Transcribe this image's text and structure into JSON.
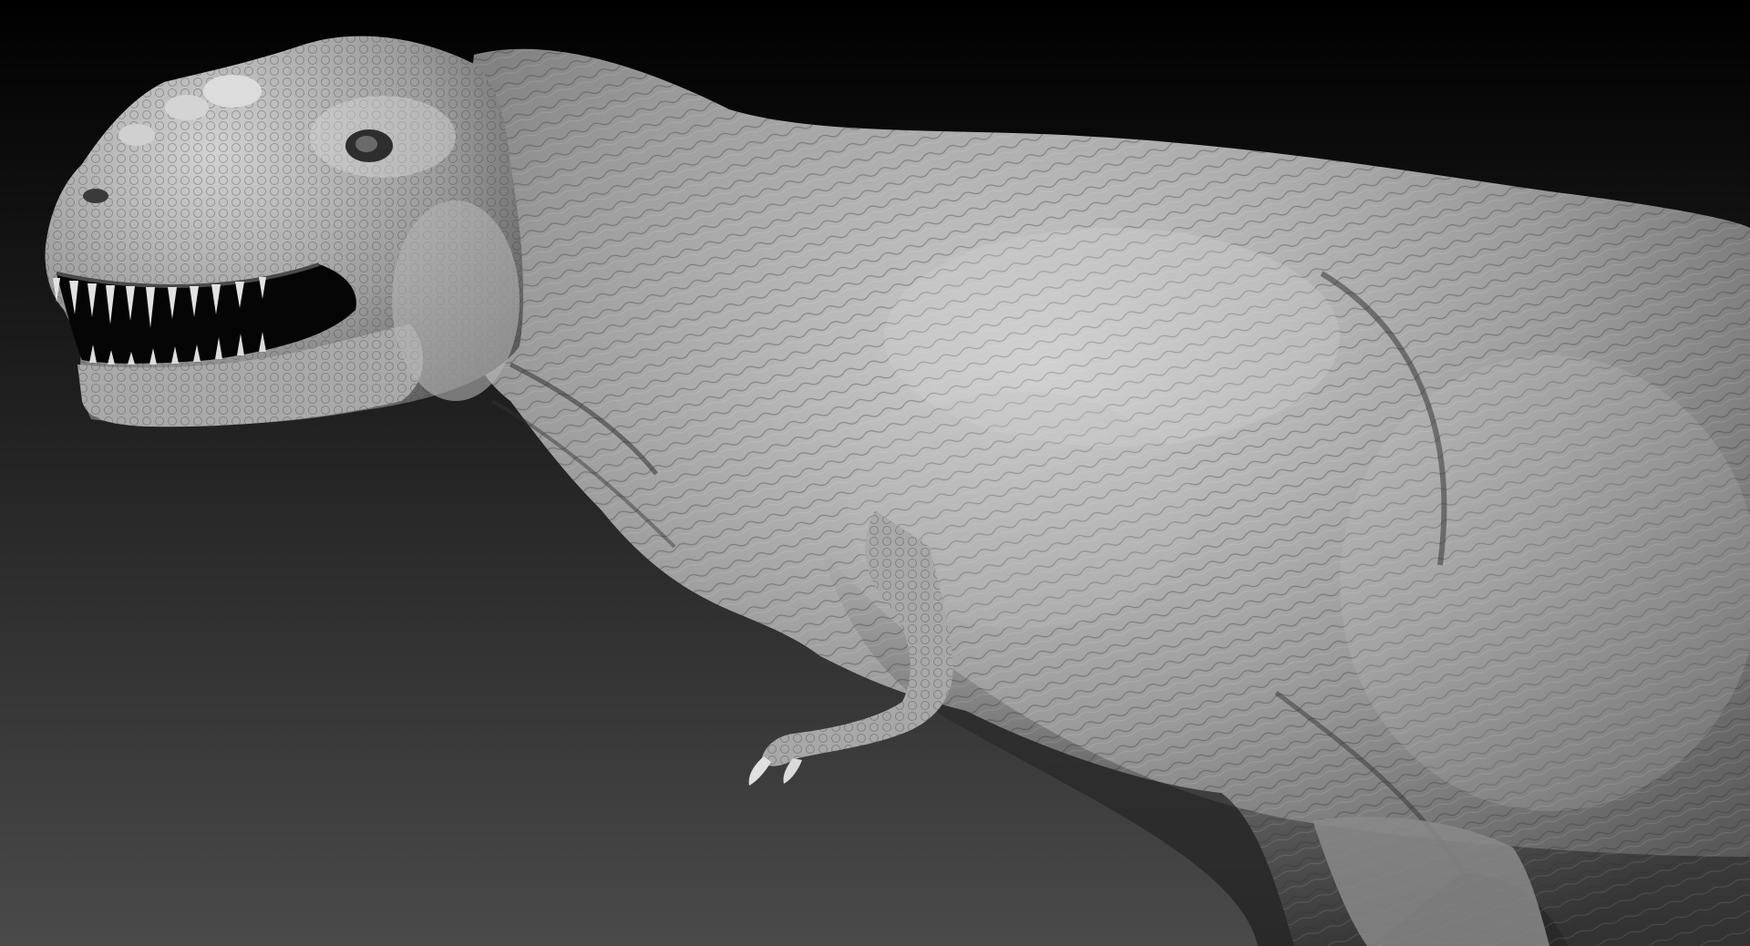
{
  "scene": {
    "subject": "t-rex-sculpt",
    "render_style": "grey-clay-matcap",
    "colors": {
      "background_top": "#000000",
      "background_bottom": "#4a4a4a",
      "clay_light": "#c8c8c8",
      "clay_mid": "#8e8e8e",
      "clay_dark": "#3a3a3a",
      "mouth_interior": "#050505",
      "teeth": "#e2e2e2"
    }
  }
}
